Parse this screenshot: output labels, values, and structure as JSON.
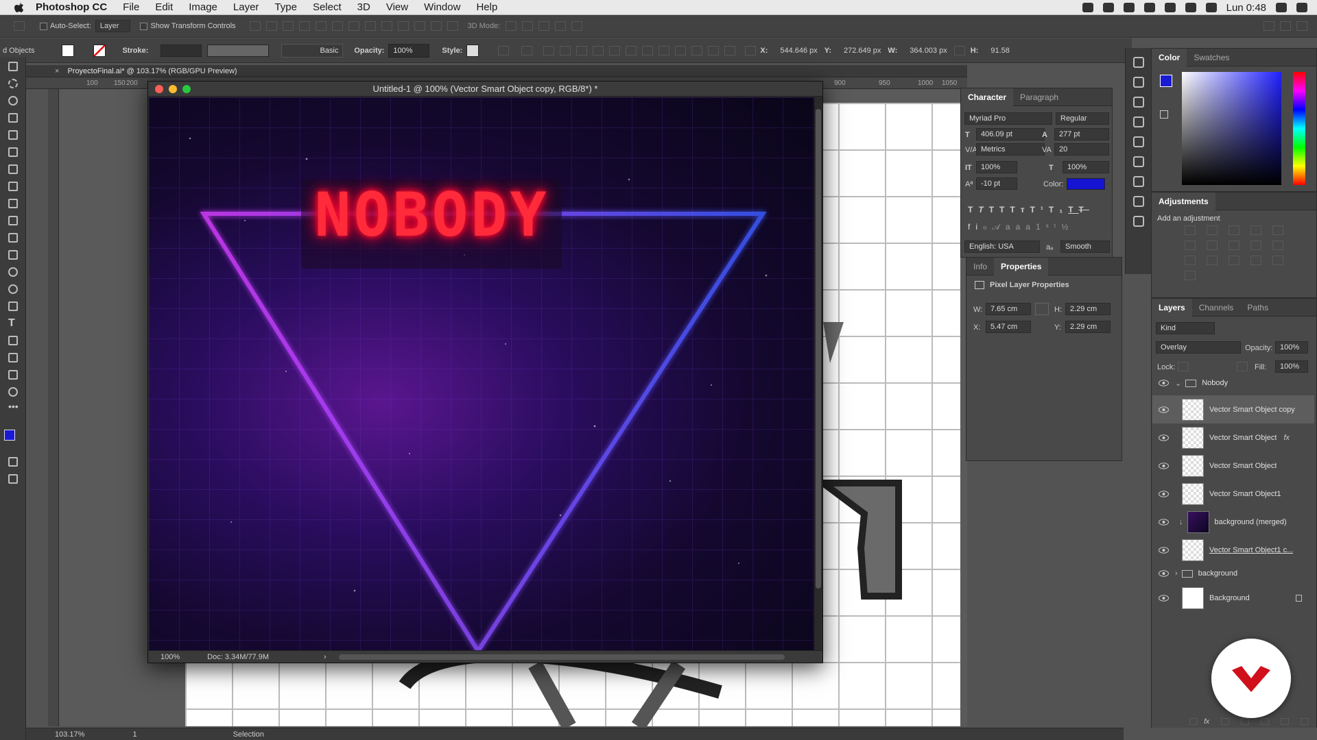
{
  "menubar": {
    "app": "Photoshop CC",
    "items": [
      "File",
      "Edit",
      "Image",
      "Layer",
      "Type",
      "Select",
      "3D",
      "View",
      "Window",
      "Help"
    ],
    "clock": "Lun 0:48"
  },
  "optbar": {
    "auto_select": "Auto-Select:",
    "auto_select_value": "Layer",
    "show_transform": "Show Transform Controls",
    "mode_3d": "3D Mode:"
  },
  "optbar2": {
    "objects": "d Objects",
    "stroke": "Stroke:",
    "stroke_style": "Basic",
    "opacity_label": "Opacity:",
    "opacity": "100%",
    "style_label": "Style:",
    "x_label": "X:",
    "x": "544.646 px",
    "y_label": "Y:",
    "y": "272.649 px",
    "w_label": "W:",
    "w": "364.003 px",
    "h_label": "H:",
    "h": "91.58"
  },
  "doc_tab": {
    "title": "ProyectoFinal.ai* @ 103.17% (RGB/GPU Preview)"
  },
  "ruler": {
    "ticks": [
      "100",
      "150",
      "200",
      "900",
      "950",
      "1000",
      "1050"
    ]
  },
  "docwin": {
    "title": "Untitled-1 @ 100% (Vector Smart Object copy, RGB/8*) *",
    "art_text": "NOBODY",
    "zoom": "100%",
    "doc": "Doc: 3.34M/77.9M"
  },
  "character": {
    "tabs": [
      "Character",
      "Paragraph"
    ],
    "font": "Myriad Pro",
    "style": "Regular",
    "size": "406.09 pt",
    "leading": "277 pt",
    "kerning": "Metrics",
    "tracking": "20",
    "vscale": "100%",
    "hscale": "100%",
    "baseline": "-10 pt",
    "color_label": "Color:",
    "language": "English: USA",
    "aa": "Smooth",
    "color": "#1414d2"
  },
  "properties": {
    "tabs": [
      "Info",
      "Properties"
    ],
    "heading": "Pixel Layer Properties",
    "w_label": "W:",
    "w": "7.65 cm",
    "h_label": "H:",
    "h": "2.29 cm",
    "x_label": "X:",
    "x": "5.47 cm",
    "y_label": "Y:",
    "y": "2.29 cm"
  },
  "color_panel": {
    "tabs": [
      "Color",
      "Swatches"
    ],
    "fg": "#1a1ad6"
  },
  "adjustments": {
    "title": "Adjustments",
    "subtitle": "Add an adjustment"
  },
  "layers": {
    "tabs": [
      "Layers",
      "Channels",
      "Paths"
    ],
    "kind": "Kind",
    "blend": "Overlay",
    "opacity_label": "Opacity:",
    "opacity": "100%",
    "lock_label": "Lock:",
    "fill_label": "Fill:",
    "fill": "100%",
    "items": [
      {
        "name": "Nobody",
        "type": "group"
      },
      {
        "name": "Vector Smart Object copy",
        "type": "smart"
      },
      {
        "name": "Vector Smart Object",
        "type": "smart"
      },
      {
        "name": "Vector Smart Object",
        "type": "smart"
      },
      {
        "name": "Vector Smart Object1",
        "type": "smart"
      },
      {
        "name": "background (merged)",
        "type": "pixel"
      },
      {
        "name": "Vector Smart Object1 c...",
        "type": "smart"
      },
      {
        "name": "background",
        "type": "group"
      },
      {
        "name": "Background",
        "type": "bg"
      }
    ]
  },
  "status": {
    "zoom": "103.17%",
    "page": "1",
    "tool": "Selection"
  }
}
